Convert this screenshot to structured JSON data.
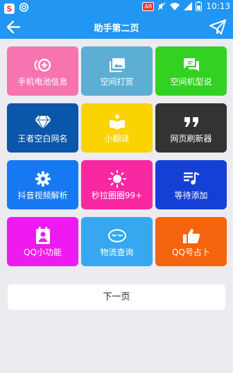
{
  "statusbar": {
    "time": "10:13",
    "badge": "AR"
  },
  "header": {
    "title": "助手第二页"
  },
  "tiles": [
    {
      "label": "手机电池信息",
      "color": "#f774b1",
      "icon": "battery-plus-icon"
    },
    {
      "label": "空间打赏",
      "color": "#5daed3",
      "icon": "photo-album-icon"
    },
    {
      "label": "空间机型说",
      "color": "#33d122",
      "icon": "chat-bubble-icon"
    },
    {
      "label": "王者空白网名",
      "color": "#0a56a8",
      "icon": "diamond-icon"
    },
    {
      "label": "小翻译",
      "color": "#fbd301",
      "icon": "book-reader-icon"
    },
    {
      "label": "网页刷新器",
      "color": "#333333",
      "icon": "quote-icon"
    },
    {
      "label": "抖音视频解析",
      "color": "#1779f1",
      "icon": "gear-icon"
    },
    {
      "label": "秒拉圈圈99+",
      "color": "#f728a2",
      "icon": "sun-icon"
    },
    {
      "label": "等待添加",
      "color": "#1540d6",
      "icon": "playlist-icon"
    },
    {
      "label": "QQ小功能",
      "color": "#ef1aef",
      "icon": "contact-card-icon"
    },
    {
      "label": "物流查询",
      "color": "#37a8f0",
      "icon": "sleepy-face-icon"
    },
    {
      "label": "QQ号占卜",
      "color": "#f5640e",
      "icon": "thumbs-up-icon"
    }
  ],
  "footer": {
    "next_label": "下一页"
  }
}
